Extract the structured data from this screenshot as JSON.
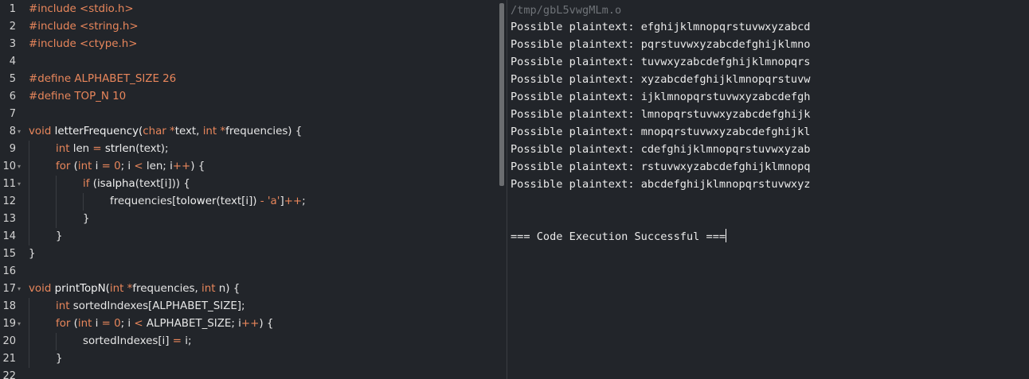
{
  "editor": {
    "lines": [
      {
        "n": "1",
        "fold": false,
        "indent": 0,
        "tokens": [
          [
            "pp",
            "#include "
          ],
          [
            "str",
            "<stdio.h>"
          ]
        ]
      },
      {
        "n": "2",
        "fold": false,
        "indent": 0,
        "tokens": [
          [
            "pp",
            "#include "
          ],
          [
            "str",
            "<string.h>"
          ]
        ]
      },
      {
        "n": "3",
        "fold": false,
        "indent": 0,
        "tokens": [
          [
            "pp",
            "#include "
          ],
          [
            "str",
            "<ctype.h>"
          ]
        ]
      },
      {
        "n": "4",
        "fold": false,
        "indent": 0,
        "tokens": []
      },
      {
        "n": "5",
        "fold": false,
        "indent": 0,
        "tokens": [
          [
            "pp",
            "#define "
          ],
          [
            "macro",
            "ALPHABET_SIZE 26"
          ]
        ]
      },
      {
        "n": "6",
        "fold": false,
        "indent": 0,
        "tokens": [
          [
            "pp",
            "#define "
          ],
          [
            "macro",
            "TOP_N 10"
          ]
        ]
      },
      {
        "n": "7",
        "fold": false,
        "indent": 0,
        "tokens": []
      },
      {
        "n": "8",
        "fold": true,
        "indent": 0,
        "tokens": [
          [
            "kw",
            "void "
          ],
          [
            "fn",
            "letterFrequency("
          ],
          [
            "kw",
            "char "
          ],
          [
            "op",
            "*"
          ],
          [
            "plain",
            "text, "
          ],
          [
            "kw",
            "int "
          ],
          [
            "op",
            "*"
          ],
          [
            "plain",
            "frequencies) {"
          ]
        ]
      },
      {
        "n": "9",
        "fold": false,
        "indent": 1,
        "tokens": [
          [
            "kw",
            "int "
          ],
          [
            "plain",
            "len "
          ],
          [
            "op",
            "= "
          ],
          [
            "fn",
            "strlen"
          ],
          [
            "plain",
            "(text);"
          ]
        ]
      },
      {
        "n": "10",
        "fold": true,
        "indent": 1,
        "tokens": [
          [
            "kw",
            "for "
          ],
          [
            "plain",
            "("
          ],
          [
            "kw",
            "int "
          ],
          [
            "plain",
            "i "
          ],
          [
            "op",
            "= "
          ],
          [
            "num",
            "0"
          ],
          [
            "plain",
            "; i "
          ],
          [
            "op",
            "< "
          ],
          [
            "plain",
            "len; i"
          ],
          [
            "op",
            "++"
          ],
          [
            "plain",
            ") {"
          ]
        ]
      },
      {
        "n": "11",
        "fold": true,
        "indent": 2,
        "tokens": [
          [
            "kw",
            "if "
          ],
          [
            "plain",
            "("
          ],
          [
            "fn",
            "isalpha"
          ],
          [
            "plain",
            "(text[i])) {"
          ]
        ]
      },
      {
        "n": "12",
        "fold": false,
        "indent": 3,
        "tokens": [
          [
            "plain",
            "frequencies["
          ],
          [
            "fn",
            "tolower"
          ],
          [
            "plain",
            "(text[i]) "
          ],
          [
            "op",
            "- "
          ],
          [
            "str",
            "'a'"
          ],
          [
            "plain",
            "]"
          ],
          [
            "op",
            "++"
          ],
          [
            "plain",
            ";"
          ]
        ]
      },
      {
        "n": "13",
        "fold": false,
        "indent": 2,
        "tokens": [
          [
            "plain",
            "}"
          ]
        ]
      },
      {
        "n": "14",
        "fold": false,
        "indent": 1,
        "tokens": [
          [
            "plain",
            "}"
          ]
        ]
      },
      {
        "n": "15",
        "fold": false,
        "indent": 0,
        "tokens": [
          [
            "plain",
            "}"
          ]
        ]
      },
      {
        "n": "16",
        "fold": false,
        "indent": 0,
        "tokens": []
      },
      {
        "n": "17",
        "fold": true,
        "indent": 0,
        "tokens": [
          [
            "kw",
            "void "
          ],
          [
            "fn",
            "printTopN("
          ],
          [
            "kw",
            "int "
          ],
          [
            "op",
            "*"
          ],
          [
            "plain",
            "frequencies, "
          ],
          [
            "kw",
            "int "
          ],
          [
            "plain",
            "n) {"
          ]
        ]
      },
      {
        "n": "18",
        "fold": false,
        "indent": 1,
        "tokens": [
          [
            "kw",
            "int "
          ],
          [
            "plain",
            "sortedIndexes[ALPHABET_SIZE];"
          ]
        ]
      },
      {
        "n": "19",
        "fold": true,
        "indent": 1,
        "tokens": [
          [
            "kw",
            "for "
          ],
          [
            "plain",
            "("
          ],
          [
            "kw",
            "int "
          ],
          [
            "plain",
            "i "
          ],
          [
            "op",
            "= "
          ],
          [
            "num",
            "0"
          ],
          [
            "plain",
            "; i "
          ],
          [
            "op",
            "< "
          ],
          [
            "plain",
            "ALPHABET_SIZE; i"
          ],
          [
            "op",
            "++"
          ],
          [
            "plain",
            ") {"
          ]
        ]
      },
      {
        "n": "20",
        "fold": false,
        "indent": 2,
        "tokens": [
          [
            "plain",
            "sortedIndexes[i] "
          ],
          [
            "op",
            "= "
          ],
          [
            "plain",
            "i;"
          ]
        ]
      },
      {
        "n": "21",
        "fold": false,
        "indent": 1,
        "tokens": [
          [
            "plain",
            "}"
          ]
        ]
      },
      {
        "n": "22",
        "fold": false,
        "indent": 0,
        "tokens": []
      }
    ]
  },
  "output": {
    "path": "/tmp/gbL5vwgMLm.o",
    "label": "Possible plaintext: ",
    "results": [
      "efghijklmnopqrstuvwxyzabcd",
      "pqrstuvwxyzabcdefghijklmno",
      "tuvwxyzabcdefghijklmnopqrs",
      "xyzabcdefghijklmnopqrstuvw",
      "ijklmnopqrstuvwxyzabcdefgh",
      "lmnopqrstuvwxyzabcdefghijk",
      "mnopqrstuvwxyzabcdefghijkl",
      "cdefghijklmnopqrstuvwxyzab",
      "rstuvwxyzabcdefghijklmnopq",
      "abcdefghijklmnopqrstuvwxyz"
    ],
    "status": "=== Code Execution Successful ==="
  },
  "theme": {
    "background": "#22252a",
    "keyword": "#e8865b",
    "text": "#e6e6e6",
    "path": "#6f7378"
  },
  "icons": {
    "fold": "chevron-down-icon"
  }
}
